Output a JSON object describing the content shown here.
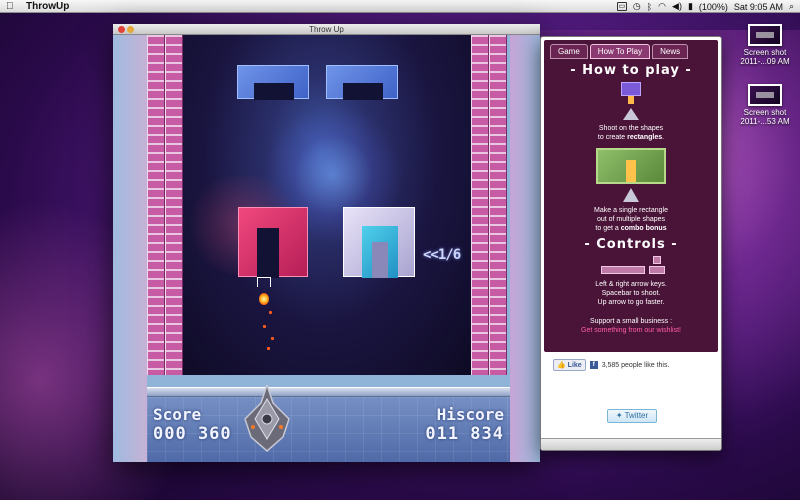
{
  "menubar": {
    "app_name": "ThrowUp",
    "battery": "(100%)",
    "clock": "Sat 9:05 AM"
  },
  "desktop": {
    "icons": [
      {
        "label_line1": "Screen shot",
        "label_line2": "2011-...09 AM"
      },
      {
        "label_line1": "Screen shot",
        "label_line2": "2011-...53 AM"
      }
    ]
  },
  "game_window": {
    "title": "Throw Up",
    "counter": "<<1/6",
    "score_label": "Score",
    "score_value": "000 360",
    "hiscore_label": "Hiscore",
    "hiscore_value": "011 834"
  },
  "widget": {
    "tabs": [
      {
        "label": "Game",
        "active": false
      },
      {
        "label": "How To Play",
        "active": true
      },
      {
        "label": "News",
        "active": false
      }
    ],
    "how_to_play_heading": "- How to play -",
    "tip1_line1": "Shoot on the shapes",
    "tip1_line2_pre": "to create ",
    "tip1_line2_bold": "rectangles",
    "tip1_line2_post": ".",
    "tip2_line1": "Make a single rectangle",
    "tip2_line2": "out of multiple shapes",
    "tip2_line3_pre": "to get a ",
    "tip2_line3_bold": "combo bonus",
    "controls_heading": "- Controls -",
    "controls_line1": "Left & right arrow keys.",
    "controls_line2": "Spacebar to shoot.",
    "controls_line3": "Up arrow to go faster.",
    "support_line1": "Support a small business :",
    "support_link": "Get something from our wishlist!",
    "fb_like": "Like",
    "fb_count": "3,585 people like this.",
    "twitter": "Twitter"
  },
  "colors": {
    "side_chevron": "#c75ca4",
    "blue_block": "#4f74d8",
    "red_block": "#d0306a",
    "cyan_block": "#2fa8d8",
    "widget_bg": "#4a1338",
    "support_link": "#ff5fa8"
  }
}
